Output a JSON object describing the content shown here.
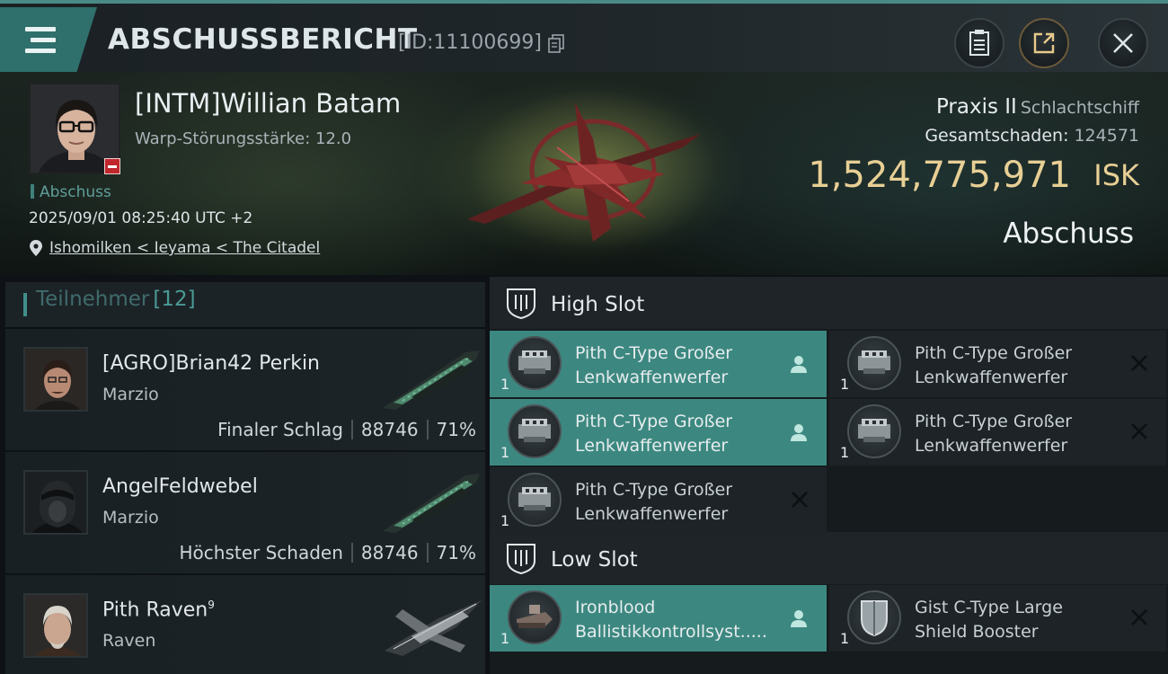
{
  "header": {
    "title": "ABSCHUSSBERICHT",
    "kill_id": "[ID:11100699]"
  },
  "victim": {
    "name": "[INTM]Willian Batam",
    "warp_line": "Warp-Störungsstärke: 12.0",
    "kill_type": "Abschuss",
    "date": "2025/09/01 08:25:40 UTC +2",
    "location": "Ishomilken < Ieyama < The Citadel",
    "ship_name": "Praxis II",
    "ship_class": "Schlachtschiff",
    "total_damage_label": "Gesamtschaden:",
    "total_damage": "124571",
    "isk_value": "1,524,775,971",
    "isk_unit": "ISK",
    "outcome": "Abschuss"
  },
  "participants": {
    "label": "Teilnehmer",
    "count": "[12]",
    "rows": [
      {
        "name": "[AGRO]Brian42 Perkin",
        "ship": "Marzio",
        "role": "Finaler Schlag",
        "damage": "88746",
        "percent": "71%"
      },
      {
        "name": "AngelFeldwebel",
        "ship": "Marzio",
        "role": "Höchster Schaden",
        "damage": "88746",
        "percent": "71%"
      },
      {
        "name": "Pith Raven",
        "name_sup": "9",
        "ship": "Raven"
      }
    ]
  },
  "fittings": {
    "high_slot_label": "High Slot",
    "low_slot_label": "Low Slot",
    "high_slots": [
      {
        "qty": "1",
        "line1": "Pith C-Type Großer",
        "line2": "Lenkwaffenwerfer",
        "state": "dropped"
      },
      {
        "qty": "1",
        "line1": "Pith C-Type Großer",
        "line2": "Lenkwaffenwerfer",
        "state": "destroyed"
      },
      {
        "qty": "1",
        "line1": "Pith C-Type Großer",
        "line2": "Lenkwaffenwerfer",
        "state": "dropped"
      },
      {
        "qty": "1",
        "line1": "Pith C-Type Großer",
        "line2": "Lenkwaffenwerfer",
        "state": "destroyed"
      },
      {
        "qty": "1",
        "line1": "Pith C-Type Großer",
        "line2": "Lenkwaffenwerfer",
        "state": "destroyed"
      }
    ],
    "low_slots": [
      {
        "qty": "1",
        "line1": "Ironblood",
        "line2": "Ballistikkontrollsyst.....",
        "state": "dropped"
      },
      {
        "qty": "1",
        "line1": "Gist C-Type Large",
        "line2": "Shield Booster",
        "state": "destroyed"
      }
    ]
  },
  "colors": {
    "accent_teal": "#3c8880",
    "isk_gold": "#e8cf95",
    "destroyed_x": "#101416"
  },
  "icons": [
    "menu-icon",
    "copy-icon",
    "notes-icon",
    "share-icon",
    "close-icon",
    "location-pin-icon",
    "shield-slot-icon",
    "person-icon",
    "x-icon"
  ]
}
